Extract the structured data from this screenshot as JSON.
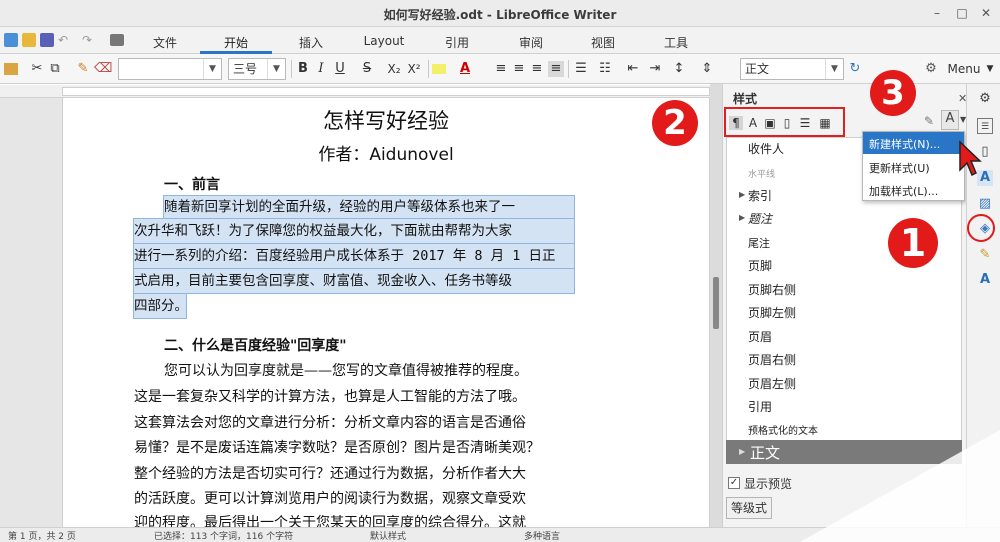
{
  "window": {
    "title": "如何写好经验.odt - LibreOffice Writer",
    "controls": {
      "minimize": "–",
      "maximize": "□",
      "close": "✕"
    }
  },
  "tabs": {
    "file": "文件",
    "home": "开始",
    "insert": "插入",
    "layout": "Layout",
    "references": "引用",
    "review": "审阅",
    "view": "视图",
    "tools": "工具"
  },
  "toolbar": {
    "font_name": "",
    "font_size": "三号",
    "bold": "B",
    "italic": "I",
    "underline": "U",
    "strike": "S",
    "subscript": "X₂",
    "superscript": "X²",
    "para_style": "正文",
    "menu_label": "Menu"
  },
  "document": {
    "title": "怎样写好经验",
    "author": "作者：Aidunovel",
    "h1": "一、前言",
    "p1": [
      "随着新回享计划的全面升级，经验的用户等级体系也来了一",
      "次升华和飞跃！为了保障您的权益最大化，下面就由帮帮为大家",
      "进行一系列的介绍：百度经验用户成长体系于 2017 年 8 月 1 日正",
      "式启用，目前主要包含回享度、财富值、现金收入、任务书等级",
      "四部分。"
    ],
    "h2": "二、什么是百度经验\"回享度\"",
    "p2": [
      "您可以认为回享度就是——您写的文章值得被推荐的程度。",
      "这是一套复杂又科学的计算方法，也算是人工智能的方法了哦。",
      "这套算法会对您的文章进行分析：分析文章内容的语言是否通俗",
      "易懂？是不是废话连篇凑字数哒？是否原创？图片是否清晰美观？",
      "整个经验的方法是否切实可行？还通过行为数据，分析作者大大",
      "的活跃度。更可以计算浏览用户的阅读行为数据，观察文章受欢",
      "迎的程度。最后得出一个关于您某天的回享度的综合得分。这就"
    ]
  },
  "sidebar": {
    "title": "样式",
    "close": "✕",
    "styles": [
      "收件人",
      "水平线",
      "索引",
      "题注",
      "尾注",
      "页脚",
      "页脚右侧",
      "页脚左侧",
      "页眉",
      "页眉右侧",
      "页眉左侧",
      "引用",
      "预格式化的文本",
      "正文"
    ],
    "show_preview": "显示预览",
    "show_preview_checked": "✓",
    "level_button": "等级式"
  },
  "menu": {
    "items": [
      "新建样式(N)...",
      "更新样式(U)",
      "加载样式(L)..."
    ]
  },
  "annotations": {
    "badge1": "1",
    "badge2": "2",
    "badge3": "3"
  },
  "statusbar": {
    "page": "第 1 页，共 2 页",
    "selection": "已选择：113 个字词，116 个字符",
    "style": "默认样式",
    "language": "多种语言"
  },
  "colors": {
    "accent": "#2a76c6",
    "annotation": "#e21a1a",
    "selection": "#d4e3f4"
  }
}
